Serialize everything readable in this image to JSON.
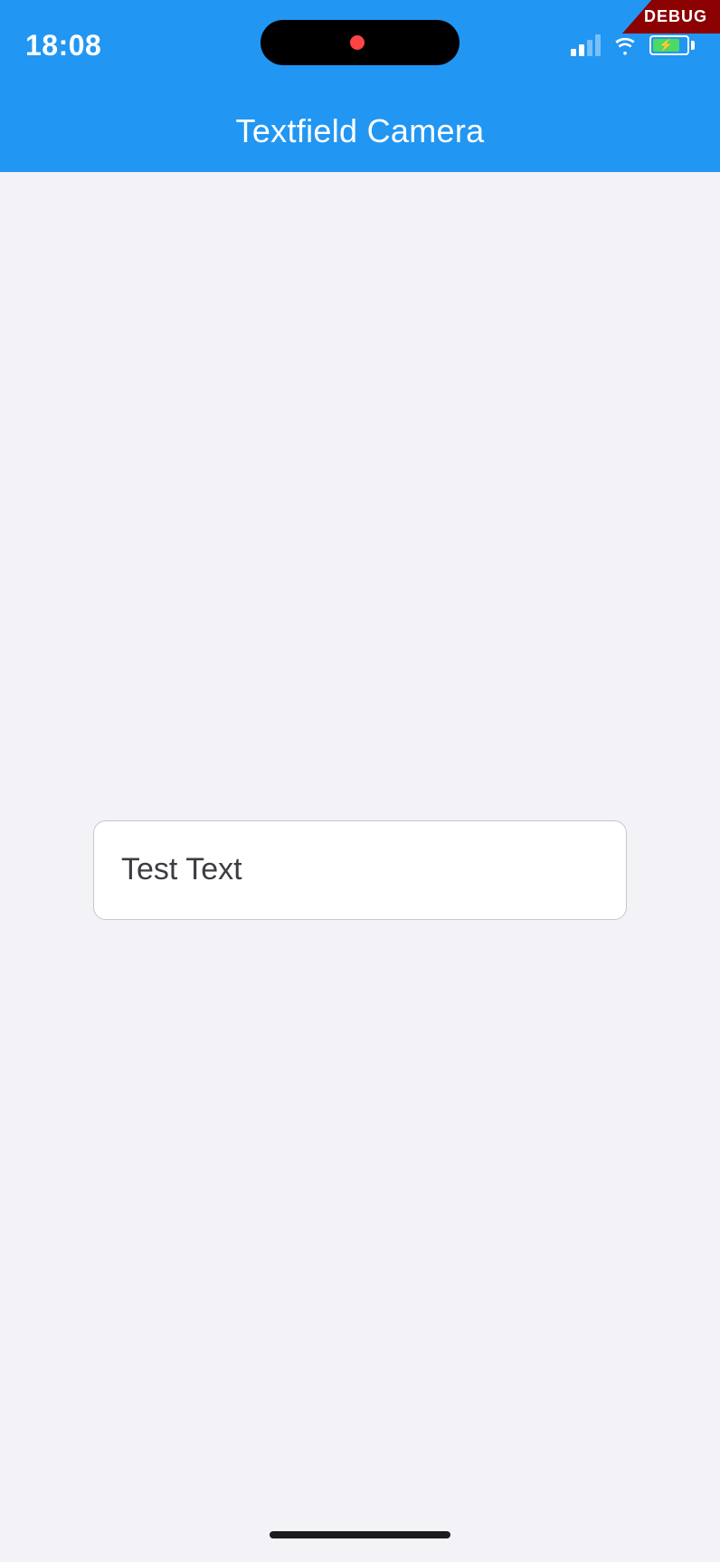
{
  "statusBar": {
    "time": "18:08",
    "debugLabel": "DEBUG"
  },
  "appBar": {
    "title": "Textfield Camera"
  },
  "textField": {
    "value": "Test Text",
    "placeholder": "Test Text"
  }
}
